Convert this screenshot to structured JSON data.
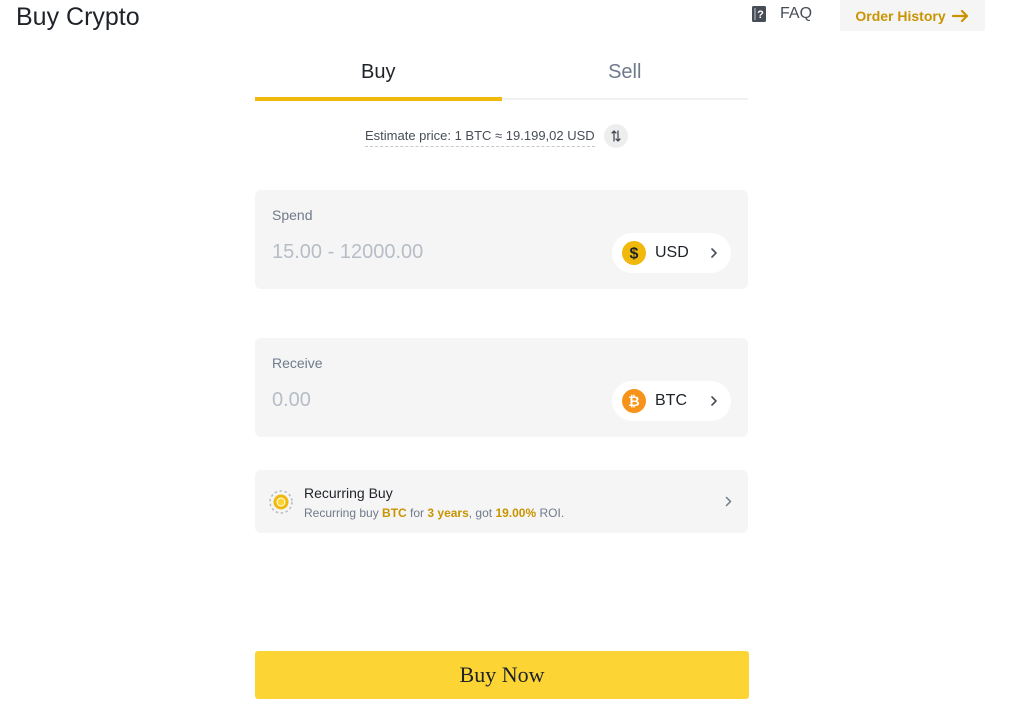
{
  "header": {
    "title": "Buy Crypto",
    "faq_label": "FAQ",
    "faq_icon": "faq-book-icon",
    "order_history_label": "Order History",
    "order_history_icon": "arrow-right-icon"
  },
  "tabs": [
    {
      "label": "Buy",
      "active": true
    },
    {
      "label": "Sell",
      "active": false
    }
  ],
  "estimate": {
    "text": "Estimate price: 1 BTC ≈ 19.199,02 USD",
    "swap_icon": "swap-arrows-icon"
  },
  "spend": {
    "label": "Spend",
    "placeholder": "15.00 - 12000.00",
    "currency": "USD",
    "currency_icon": "usd-coin-icon"
  },
  "receive": {
    "label": "Receive",
    "placeholder": "0.00",
    "currency": "BTC",
    "currency_icon": "btc-coin-icon"
  },
  "recurring": {
    "title": "Recurring Buy",
    "desc_prefix": "Recurring buy ",
    "asset": "BTC",
    "desc_for": " for ",
    "period": "3 years",
    "desc_got": ", got ",
    "roi": "19.00%",
    "desc_suffix": " ROI.",
    "icon": "recurring-coin-icon"
  },
  "action": {
    "buy_now_label": "Buy Now"
  },
  "colors": {
    "accent": "#f0b90b",
    "button": "#fcd535",
    "highlight": "#c99400",
    "btc": "#f7931a"
  }
}
